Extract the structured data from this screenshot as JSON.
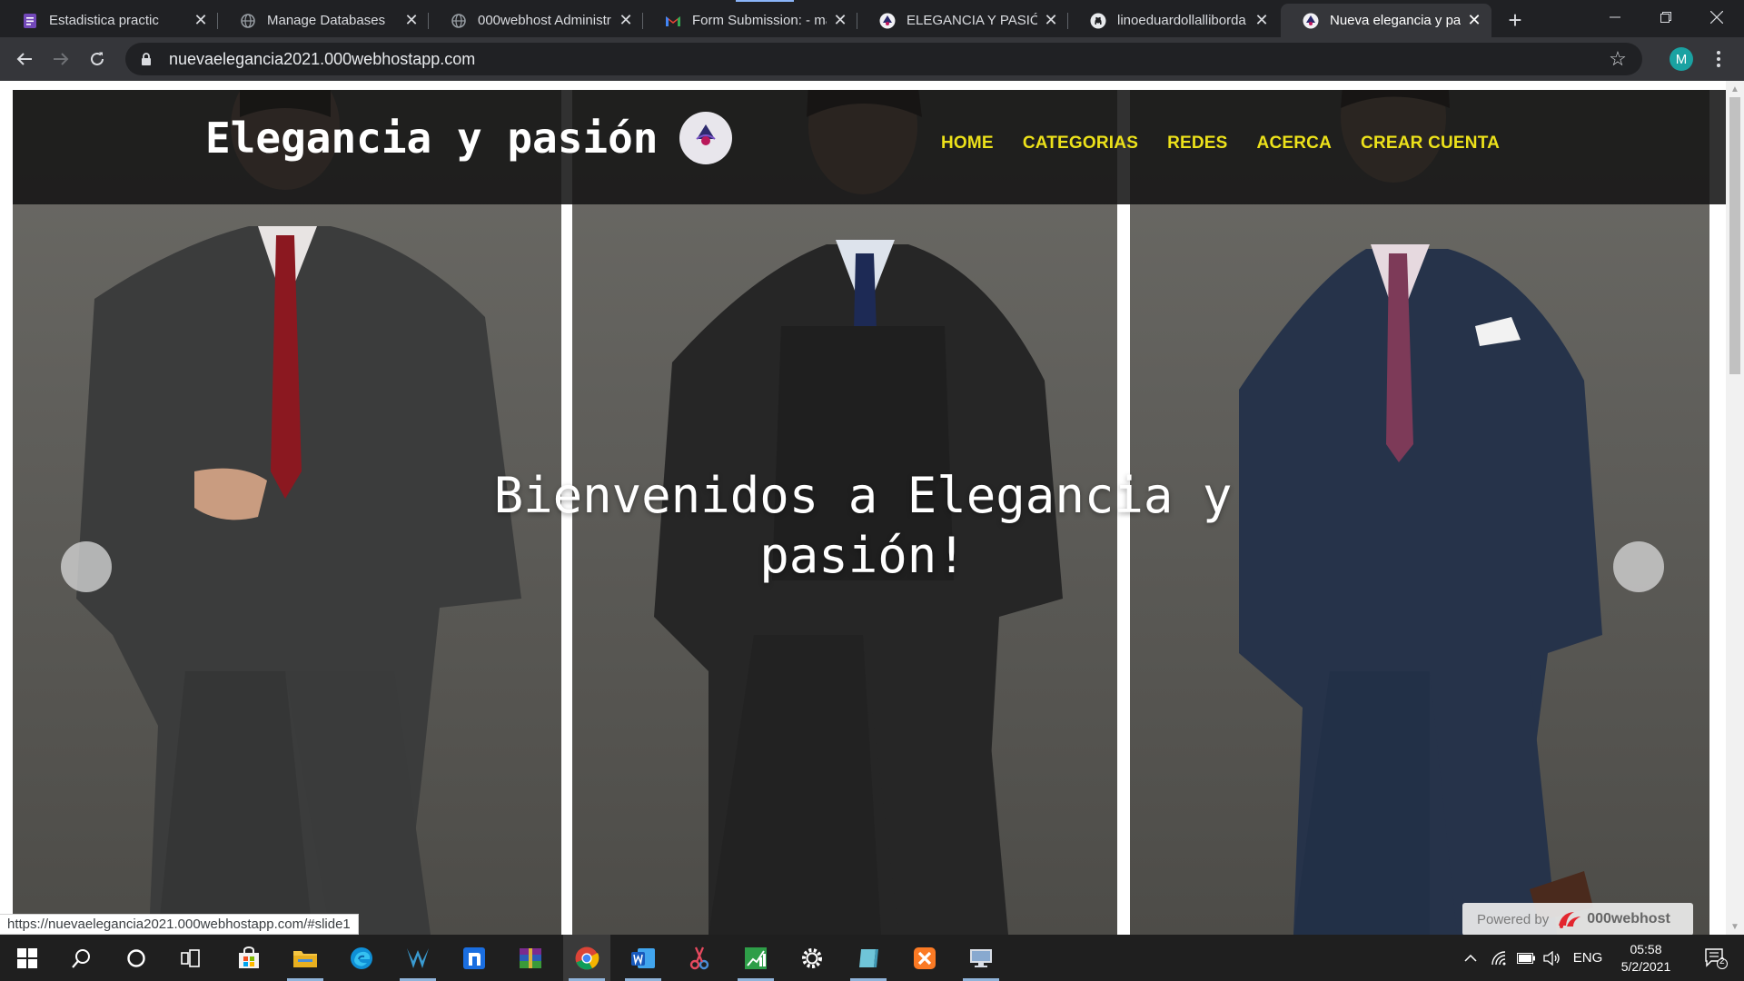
{
  "browser": {
    "tabs": [
      {
        "title": "Estadistica practic",
        "icon": "form-icon",
        "active": false
      },
      {
        "title": "Manage Databases",
        "icon": "globe-icon",
        "active": false
      },
      {
        "title": "000webhost Administr",
        "icon": "globe-icon",
        "active": false
      },
      {
        "title": "Form Submission: - ma",
        "icon": "gmail-icon",
        "active": false
      },
      {
        "title": "ELEGANCIA Y PASIÓN",
        "icon": "site-logo-icon",
        "active": false
      },
      {
        "title": "linoeduardollalliborda",
        "icon": "github-icon",
        "active": false
      },
      {
        "title": "Nueva elegancia y pasi",
        "icon": "site-logo-icon",
        "active": true
      }
    ],
    "new_tab_symbol": "+",
    "url": "nuevaelegancia2021.000webhostapp.com",
    "profile_initial": "M",
    "status_url": "https://nuevaelegancia2021.000webhostapp.com/#slide1"
  },
  "site": {
    "title": "Elegancia y pasión",
    "nav": [
      {
        "label": "HOME"
      },
      {
        "label": "CATEGORIAS"
      },
      {
        "label": "REDES"
      },
      {
        "label": "ACERCA"
      },
      {
        "label": "CREAR CUENTA"
      }
    ],
    "hero_line1": "Bienvenidos a Elegancia y",
    "hero_line2": "pasión!",
    "powered_by": "Powered by",
    "powered_brand": "000webhost",
    "nav_color": "#ece11a"
  },
  "taskbar": {
    "language": "ENG",
    "time": "05:58",
    "date": "5/2/2021",
    "notification_count": "2"
  }
}
